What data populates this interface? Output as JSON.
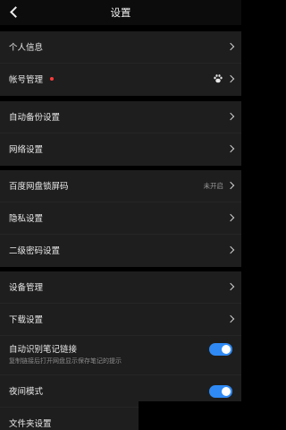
{
  "header": {
    "title": "设置"
  },
  "group1": [
    {
      "label": "个人信息"
    },
    {
      "label": "帐号管理"
    }
  ],
  "group2": [
    {
      "label": "自动备份设置"
    },
    {
      "label": "网络设置"
    }
  ],
  "group3": [
    {
      "label": "百度网盘锁屏码",
      "value": "未开启"
    },
    {
      "label": "隐私设置"
    },
    {
      "label": "二级密码设置"
    }
  ],
  "group4": [
    {
      "label": "设备管理"
    },
    {
      "label": "下载设置"
    },
    {
      "label": "自动识别笔记链接",
      "sub": "复制链接后打开网盘显示保存笔记的提示",
      "on": true
    },
    {
      "label": "夜间模式",
      "on": true
    },
    {
      "label": "文件夹设置"
    }
  ]
}
